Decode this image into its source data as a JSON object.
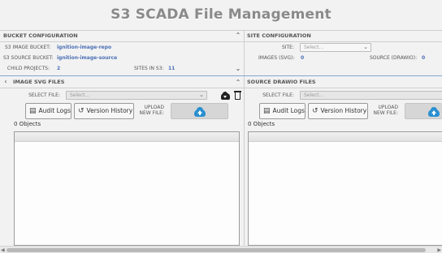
{
  "page": {
    "title": "S3 SCADA File Management"
  },
  "bucket_config": {
    "header": "BUCKET CONFIGURATION",
    "image_bucket_label": "S3 IMAGE BUCKET:",
    "image_bucket_value": "ignition-image-repo",
    "source_bucket_label": "S3 SOURCE BUCKET:",
    "source_bucket_value": "ignition-image-source",
    "child_projects_label": "CHILD PROJECTS:",
    "child_projects_value": "2",
    "sites_label": "SITES IN S3:",
    "sites_value": "11"
  },
  "site_config": {
    "header": "SITE CONFIGURATION",
    "site_label": "SITE:",
    "site_placeholder": "Select...",
    "images_label": "IMAGES (SVG):",
    "images_value": "0",
    "source_label": "SOURCE (DRAWIO):",
    "source_value": "0"
  },
  "svg_panel": {
    "header": "IMAGE SVG FILES",
    "select_file_label": "SELECT FILE:",
    "select_placeholder": "Select...",
    "audit_logs": "Audit Logs",
    "version_history": "Version History",
    "upload_label_1": "UPLOAD",
    "upload_label_2": "NEW FILE:",
    "object_count": "0 Objects"
  },
  "drawio_panel": {
    "header": "SOURCE DRAWIO FILES",
    "select_file_label": "SELECT FILE:",
    "select_placeholder": "Select...",
    "audit_logs": "Audit Logs",
    "version_history": "Version History",
    "upload_label_1": "UPLOAD",
    "upload_label_2": "NEW FILE:",
    "object_count": "0 Objects"
  }
}
